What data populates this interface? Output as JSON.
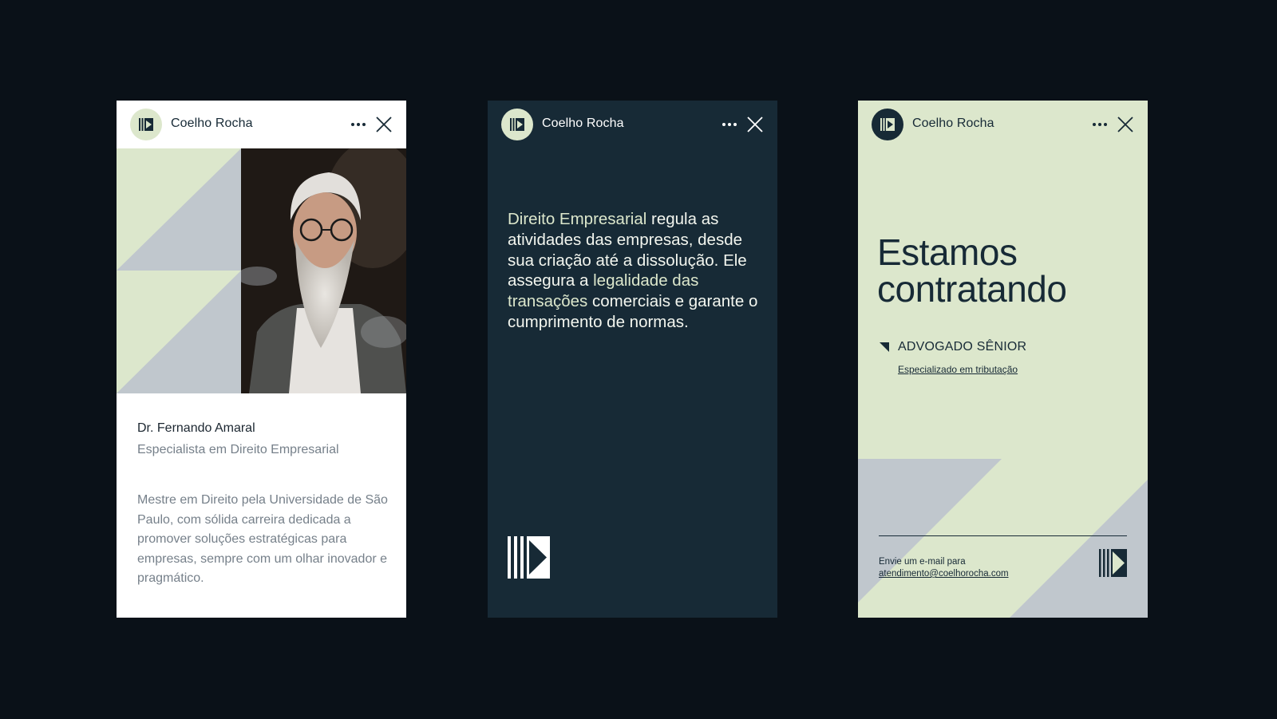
{
  "colors": {
    "background": "#0a1118",
    "navy": "#172a36",
    "mint": "#dce7cc",
    "slate": "#c0c7cd",
    "muted_text": "#76808a",
    "white": "#ffffff"
  },
  "icons": {
    "brand_logo": "bars-play-icon",
    "more": "more-horizontal-icon",
    "close": "close-icon"
  },
  "cards": [
    {
      "brand": "Coelho Rocha",
      "name": "Dr. Fernando Amaral",
      "role": "Especialista em Direito Empresarial",
      "bio": "Mestre em Direito pela Universidade de São Paulo, com sólida carreira dedicada a promover soluções estratégicas para empresas, sempre com um olhar inovador e pragmático."
    },
    {
      "brand": "Coelho Rocha",
      "text_parts": {
        "p1_hl": "Direito Empresarial",
        "p2": " regula as atividades das empresas, desde sua criação até a dissolução. Ele assegura a ",
        "p3_hl": "legalidade das transações",
        "p4": " comerciais e garante o cumprimento de normas."
      }
    },
    {
      "brand": "Coelho Rocha",
      "headline": "Estamos contratando",
      "job_title": "ADVOGADO SÊNIOR",
      "job_spec": "Especializado em tributação",
      "send_label": "Envie um e-mail para",
      "email": "atendimento@coelhorocha.com"
    }
  ]
}
